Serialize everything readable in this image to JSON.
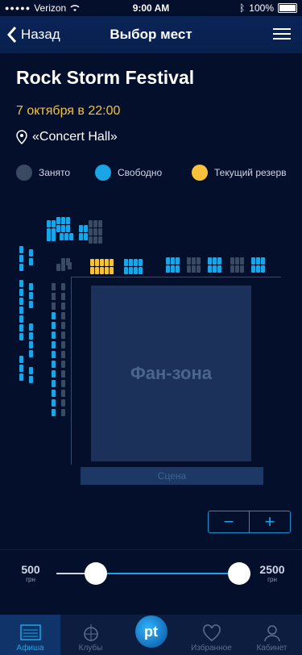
{
  "status_bar": {
    "carrier": "Verizon",
    "time": "9:00 AM",
    "battery": "100%"
  },
  "nav": {
    "back_label": "Назад",
    "title": "Выбор мест"
  },
  "event": {
    "title": "Rock Storm Festival",
    "date": "7 октября в 22:00",
    "venue": "«Concert Hall»"
  },
  "legend": {
    "busy": {
      "label": "Занято",
      "color": "#3b4a63"
    },
    "free": {
      "label": "Свободно",
      "color": "#1aa6e6"
    },
    "current": {
      "label": "Текущий резерв",
      "color": "#f6c23c"
    }
  },
  "map": {
    "fan_zone": "Фан-зона",
    "stage": "Сцена"
  },
  "zoom": {
    "minus": "−",
    "plus": "+"
  },
  "price": {
    "min": "500",
    "max": "2500",
    "currency": "грн"
  },
  "tabs": [
    {
      "label": "Афиша",
      "icon": "poster-icon",
      "active": true
    },
    {
      "label": "Клубы",
      "icon": "disco-ball-icon"
    },
    {
      "label": "",
      "icon": "pt-logo-icon"
    },
    {
      "label": "Избранное",
      "icon": "heart-icon"
    },
    {
      "label": "Кабинет",
      "icon": "user-icon"
    }
  ]
}
